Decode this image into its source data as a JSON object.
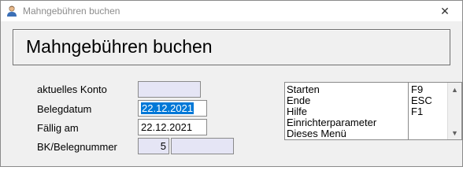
{
  "window": {
    "title": "Mahngebühren buchen",
    "close_glyph": "✕"
  },
  "header": {
    "title": "Mahngebühren buchen"
  },
  "form": {
    "konto_label": "aktuelles Konto",
    "konto_value": "",
    "belegdatum_label": "Belegdatum",
    "belegdatum_value": "22.12.2021",
    "faellig_label": "Fällig am",
    "faellig_value": "22.12.2021",
    "bk_label": "BK/Belegnummer",
    "bk_value": "5",
    "belegnummer_value": ""
  },
  "menu": {
    "items": [
      {
        "label": "Starten",
        "key": "F9"
      },
      {
        "label": "Ende",
        "key": "ESC"
      },
      {
        "label": "Hilfe",
        "key": "F1"
      },
      {
        "label": "Einrichterparameter",
        "key": ""
      },
      {
        "label": "Dieses Menü",
        "key": ""
      }
    ]
  },
  "colors": {
    "selection": "#0078d7",
    "readonly_field": "#e5e5f5"
  }
}
